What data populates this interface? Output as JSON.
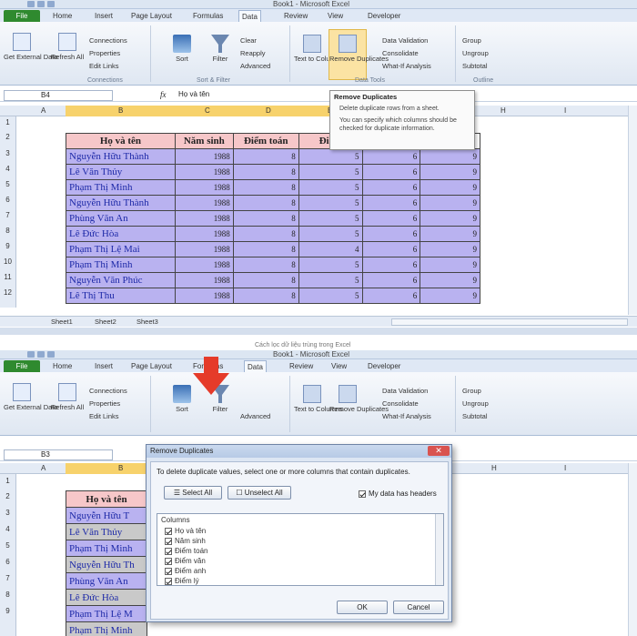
{
  "top": {
    "window_title": "Book1 - Microsoft Excel",
    "tabs": [
      "File",
      "Home",
      "Insert",
      "Page Layout",
      "Formulas",
      "Data",
      "Review",
      "View",
      "Developer"
    ],
    "active_tab": "Data",
    "ribbon": {
      "get_external_data": "Get External Data",
      "refresh_all": "Refresh All",
      "connections": "Connections",
      "properties": "Properties",
      "edit_links": "Edit Links",
      "sort": "Sort",
      "filter": "Filter",
      "clear": "Clear",
      "reapply": "Reapply",
      "advanced": "Advanced",
      "text_to_columns": "Text to Columns",
      "remove_duplicates": "Remove Duplicates",
      "data_validation": "Data Validation",
      "consolidate": "Consolidate",
      "what_if": "What-If Analysis",
      "group": "Group",
      "ungroup": "Ungroup",
      "subtotal": "Subtotal",
      "group_connections": "Connections",
      "group_sort_filter": "Sort & Filter",
      "group_data_tools": "Data Tools",
      "group_outline": "Outline"
    },
    "name_box": "B4",
    "fx": "fx",
    "formula_value": "Họ và tên",
    "tooltip": {
      "title": "Remove Duplicates",
      "line1": "Delete duplicate rows from a sheet.",
      "line2": "You can specify which columns should be checked for duplicate information."
    },
    "columns": [
      "A",
      "B",
      "C",
      "D",
      "E",
      "F",
      "G",
      "H",
      "I"
    ],
    "rows": [
      "1",
      "2",
      "3",
      "4",
      "5",
      "6",
      "7",
      "8",
      "9",
      "10",
      "11",
      "12"
    ],
    "table_headers": [
      "Họ và tên",
      "Năm sinh",
      "Điểm toán",
      "Điểm",
      "",
      ""
    ],
    "table_rows": [
      [
        "Nguyễn Hữu Thành",
        "1988",
        "8",
        "5",
        "6",
        "9"
      ],
      [
        "Lê Văn Thủy",
        "1988",
        "8",
        "5",
        "6",
        "9"
      ],
      [
        "Phạm Thị Minh",
        "1988",
        "8",
        "5",
        "6",
        "9"
      ],
      [
        "Nguyễn Hữu Thành",
        "1988",
        "8",
        "5",
        "6",
        "9"
      ],
      [
        "Phùng Văn An",
        "1988",
        "8",
        "5",
        "6",
        "9"
      ],
      [
        "Lê Đức Hòa",
        "1988",
        "8",
        "5",
        "6",
        "9"
      ],
      [
        "Phạm Thị Lệ Mai",
        "1988",
        "8",
        "4",
        "6",
        "9"
      ],
      [
        "Phạm Thị Minh",
        "1988",
        "8",
        "5",
        "6",
        "9"
      ],
      [
        "Nguyễn Văn Phúc",
        "1988",
        "8",
        "5",
        "6",
        "9"
      ],
      [
        "Lê Thị Thu",
        "1988",
        "8",
        "5",
        "6",
        "9"
      ]
    ],
    "sheet_tabs": [
      "Sheet1",
      "Sheet2",
      "Sheet3"
    ],
    "caption": "Cách lọc dữ liệu trùng trong Excel"
  },
  "bottom": {
    "window_title": "Book1 - Microsoft Excel",
    "tabs": [
      "File",
      "Home",
      "Insert",
      "Page Layout",
      "Formulas",
      "Data",
      "Review",
      "View",
      "Developer"
    ],
    "name_box": "B3",
    "columns": [
      "A",
      "B",
      "C",
      "D",
      "E",
      "F",
      "G",
      "H",
      "I"
    ],
    "rows": [
      "1",
      "2",
      "3",
      "4",
      "5",
      "6",
      "7",
      "8",
      "9"
    ],
    "partial_rows": [
      "Họ và tên",
      "Nguyễn Hữu T",
      "Lê Văn Thủy",
      "Phạm Thị Minh",
      "Nguyễn Hữu Th",
      "Phùng Văn An",
      "Lê Đức Hòa",
      "Phạm Thị Lệ M",
      "Phạm Thị Minh"
    ],
    "dialog": {
      "title": "Remove Duplicates",
      "close": "✕",
      "instruction": "To delete duplicate values, select one or more columns that contain duplicates.",
      "select_all": "Select All",
      "unselect_all": "Unselect All",
      "my_data_has_headers": "My data has headers",
      "columns_label": "Columns",
      "items": [
        "Họ và tên",
        "Năm sinh",
        "Điểm toán",
        "Điểm văn",
        "Điểm anh",
        "Điểm lý"
      ],
      "ok": "OK",
      "cancel": "Cancel"
    }
  },
  "colors": {
    "accent_red": "#e53b2a",
    "file_tab": "#2f8a2f",
    "header_pink": "#f6c7c9",
    "lavender": "#b9b2f0"
  }
}
